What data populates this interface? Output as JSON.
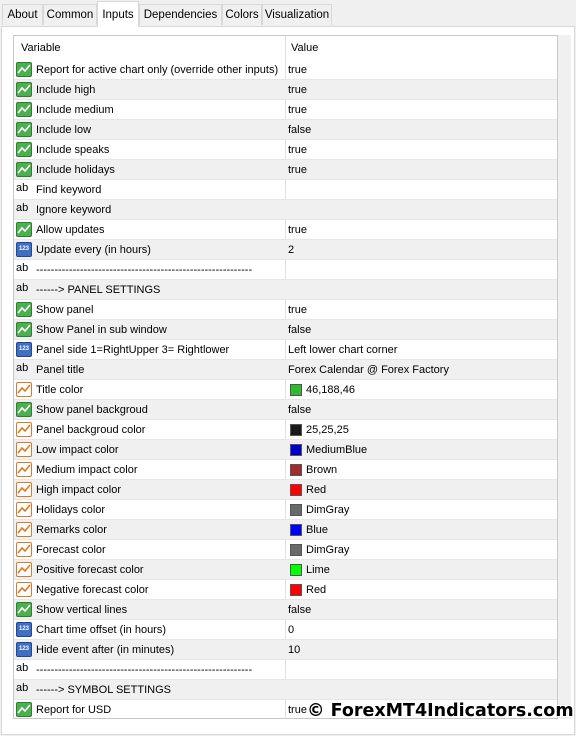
{
  "tabs": [
    {
      "label": "About"
    },
    {
      "label": "Common"
    },
    {
      "label": "Inputs",
      "active": true
    },
    {
      "label": "Dependencies"
    },
    {
      "label": "Colors"
    },
    {
      "label": "Visualization"
    }
  ],
  "grid": {
    "header": {
      "variable": "Variable",
      "value": "Value"
    },
    "rows": [
      {
        "type": "bool",
        "variable": "Report for active chart only (override other inputs)",
        "value": "true"
      },
      {
        "type": "bool",
        "variable": "Include high",
        "value": "true"
      },
      {
        "type": "bool",
        "variable": "Include medium",
        "value": "true"
      },
      {
        "type": "bool",
        "variable": "Include low",
        "value": "false"
      },
      {
        "type": "bool",
        "variable": "Include speaks",
        "value": "true"
      },
      {
        "type": "bool",
        "variable": "Include holidays",
        "value": "true"
      },
      {
        "type": "string",
        "variable": "Find keyword",
        "value": ""
      },
      {
        "type": "string",
        "variable": "Ignore keyword",
        "value": ""
      },
      {
        "type": "bool",
        "variable": "Allow updates",
        "value": "true"
      },
      {
        "type": "int",
        "variable": "Update every (in hours)",
        "value": "2"
      },
      {
        "type": "string",
        "variable": "-----------------------------------------------------------",
        "value": ""
      },
      {
        "type": "string",
        "variable": "------> PANEL SETTINGS",
        "value": ""
      },
      {
        "type": "bool",
        "variable": "Show panel",
        "value": "true"
      },
      {
        "type": "bool",
        "variable": "Show Panel in sub window",
        "value": "false"
      },
      {
        "type": "int",
        "variable": "Panel side 1=RightUpper 3= Rightlower",
        "value": "Left lower chart corner"
      },
      {
        "type": "string",
        "variable": "Panel title",
        "value": "Forex Calendar @ Forex Factory"
      },
      {
        "type": "color",
        "variable": "Title color",
        "value": "46,188,46",
        "color": "#2ebc2e"
      },
      {
        "type": "bool",
        "variable": "Show panel backgroud",
        "value": "false"
      },
      {
        "type": "color",
        "variable": "Panel backgroud color",
        "value": "25,25,25",
        "color": "#191919"
      },
      {
        "type": "color",
        "variable": "Low impact color",
        "value": "MediumBlue",
        "color": "#0000cd"
      },
      {
        "type": "color",
        "variable": "Medium impact color",
        "value": "Brown",
        "color": "#a52a2a"
      },
      {
        "type": "color",
        "variable": "High impact color",
        "value": "Red",
        "color": "#ff0000"
      },
      {
        "type": "color",
        "variable": "Holidays color",
        "value": "DimGray",
        "color": "#696969"
      },
      {
        "type": "color",
        "variable": "Remarks color",
        "value": "Blue",
        "color": "#0000ff"
      },
      {
        "type": "color",
        "variable": "Forecast color",
        "value": "DimGray",
        "color": "#696969"
      },
      {
        "type": "color",
        "variable": "Positive forecast color",
        "value": "Lime",
        "color": "#00ff00"
      },
      {
        "type": "color",
        "variable": "Negative forecast color",
        "value": "Red",
        "color": "#ff0000"
      },
      {
        "type": "bool",
        "variable": "Show vertical lines",
        "value": "false"
      },
      {
        "type": "int",
        "variable": "Chart time offset (in hours)",
        "value": "0"
      },
      {
        "type": "int",
        "variable": "Hide event after (in minutes)",
        "value": "10"
      },
      {
        "type": "string",
        "variable": "-----------------------------------------------------------",
        "value": ""
      },
      {
        "type": "string",
        "variable": "------> SYMBOL SETTINGS",
        "value": ""
      },
      {
        "type": "bool",
        "variable": "Report for USD",
        "value": "true"
      }
    ]
  },
  "icons": {
    "bool": "bool-param-icon",
    "string": "string-param-icon",
    "int": "int-param-icon",
    "color": "color-param-icon"
  },
  "icon_text": {
    "string": "ab",
    "int": "123"
  },
  "watermark": "© ForexMT4Indicators.com"
}
